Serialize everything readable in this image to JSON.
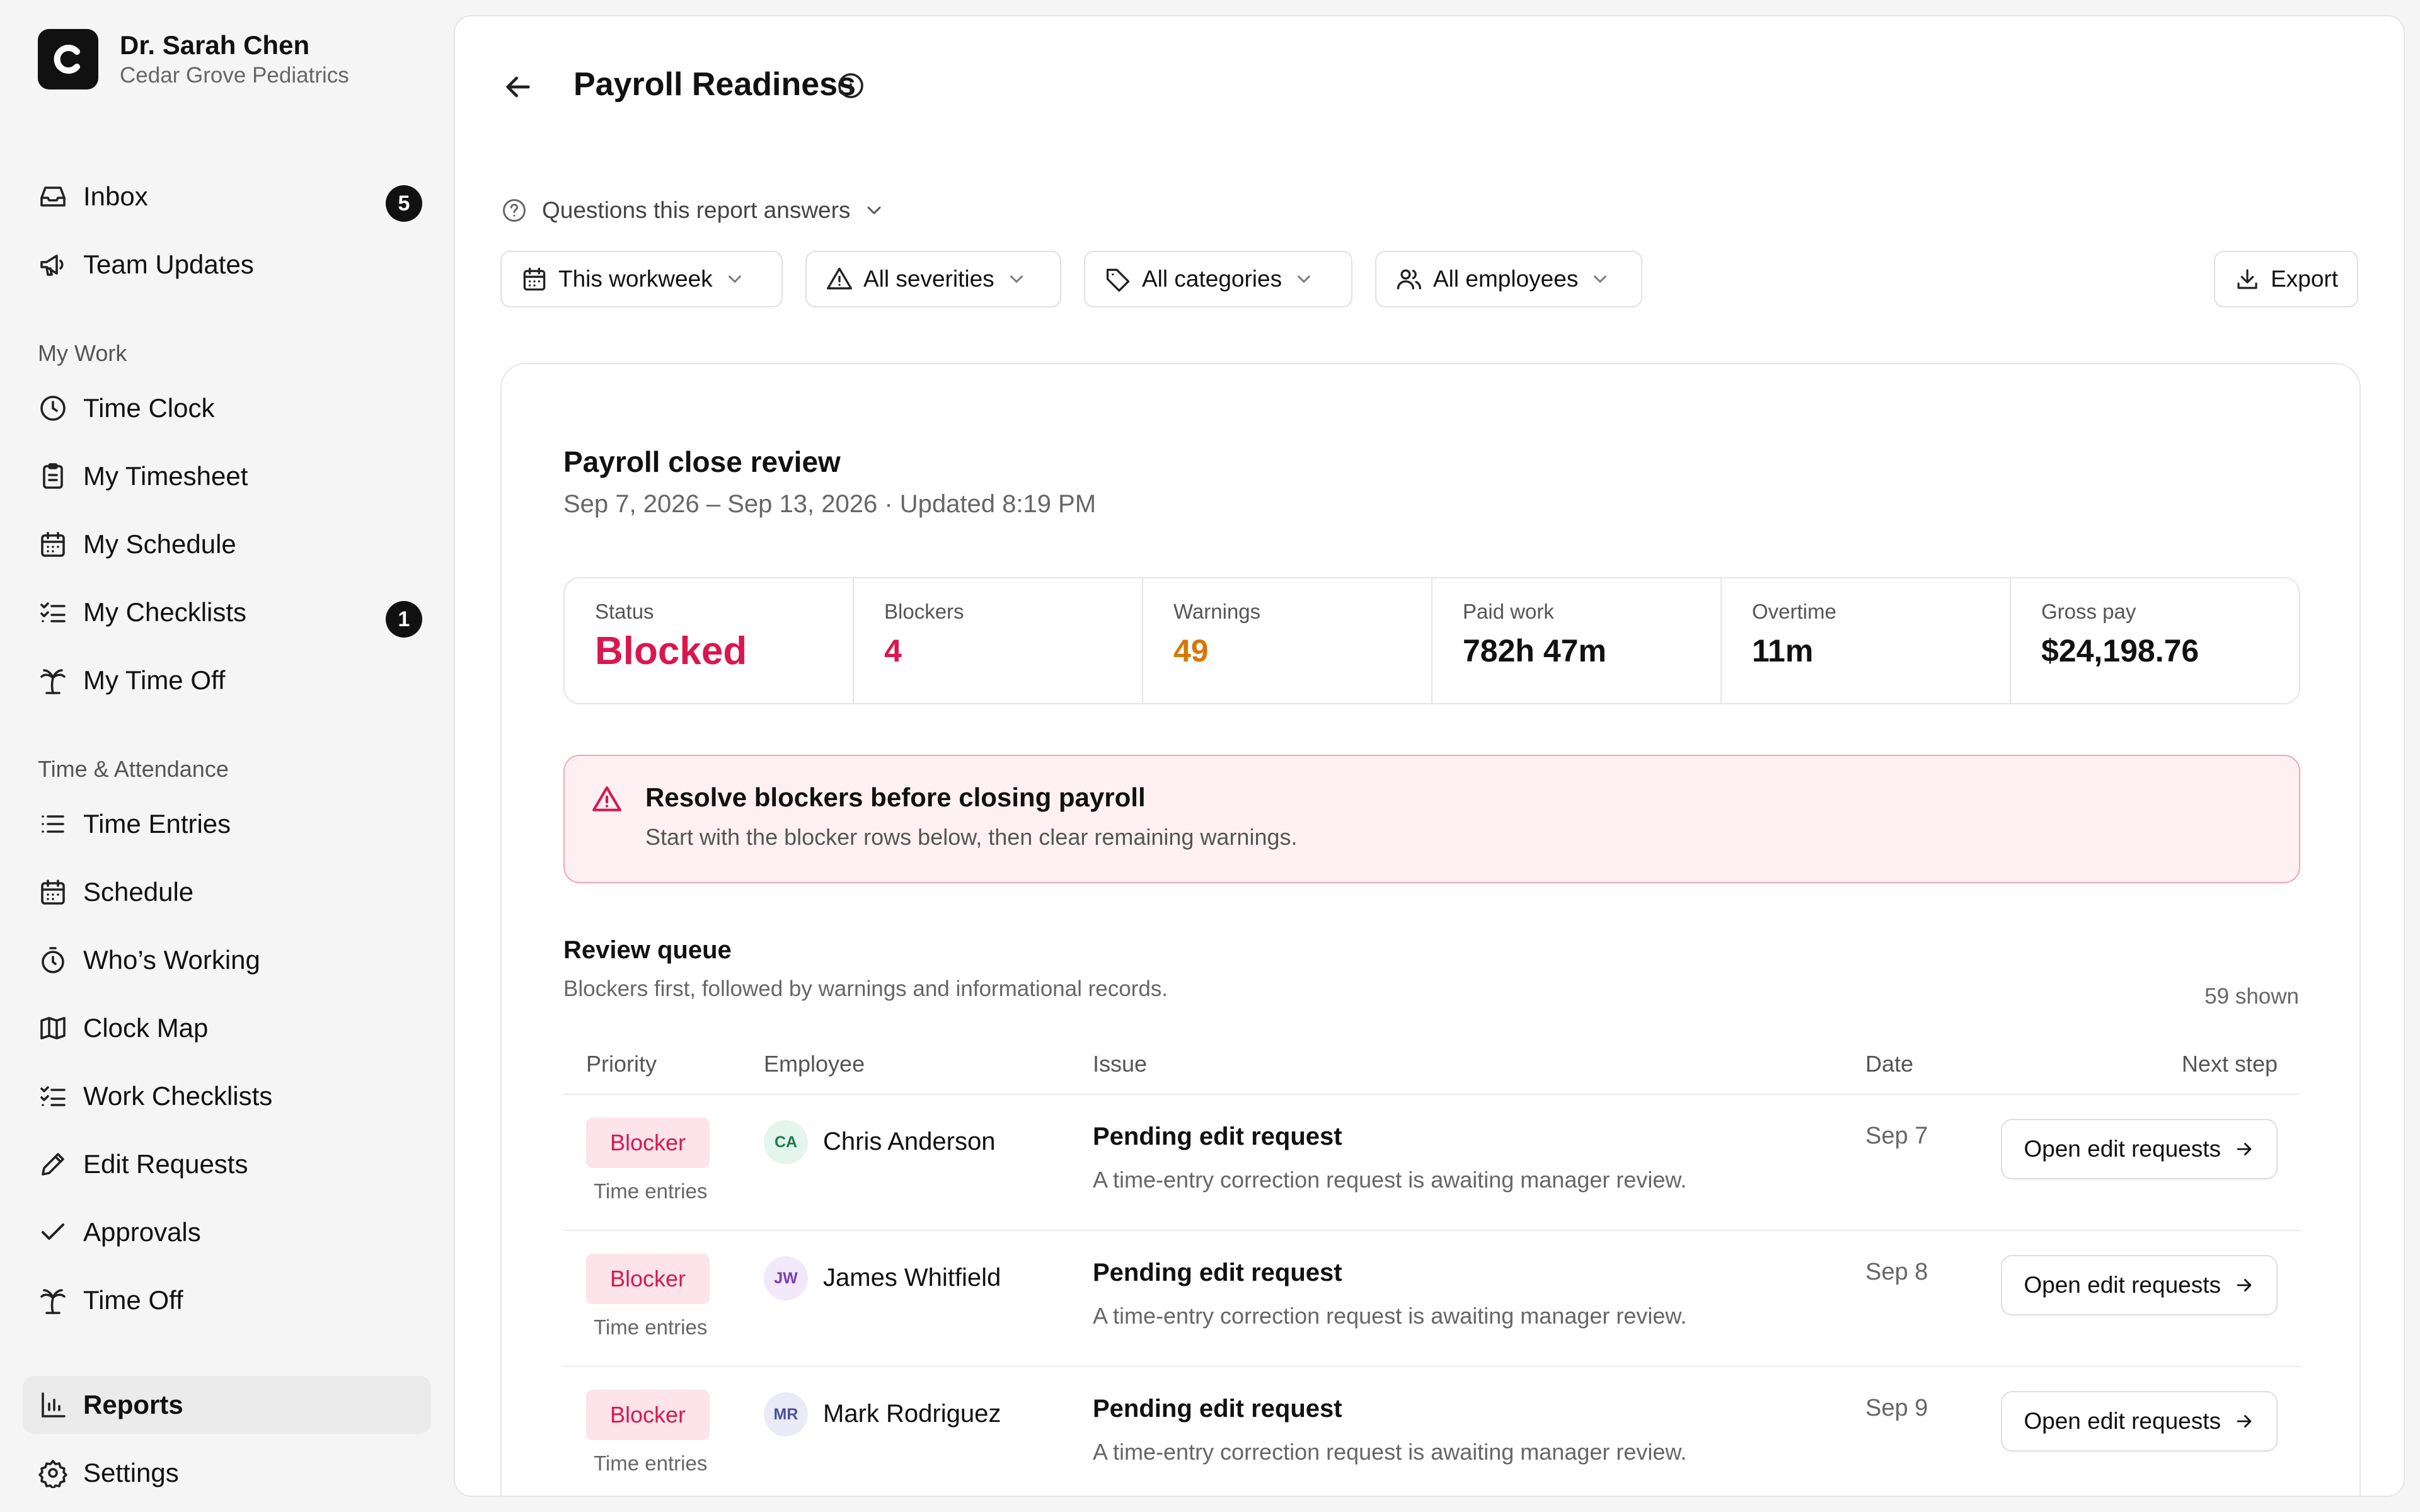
{
  "profile": {
    "name": "Dr. Sarah Chen",
    "org": "Cedar Grove Pediatrics"
  },
  "sidebar": {
    "top_items": [
      {
        "label": "Inbox",
        "badge": "5",
        "icon": "inbox-icon"
      },
      {
        "label": "Team Updates",
        "icon": "megaphone-icon"
      }
    ],
    "my_work": {
      "title": "My Work",
      "items": [
        {
          "label": "Time Clock",
          "icon": "clock-icon"
        },
        {
          "label": "My Timesheet",
          "icon": "clipboard-icon"
        },
        {
          "label": "My Schedule",
          "icon": "calendar-icon"
        },
        {
          "label": "My Checklists",
          "badge": "1",
          "icon": "checklist-icon"
        },
        {
          "label": "My Time Off",
          "icon": "palm-tree-icon"
        }
      ]
    },
    "time_attendance": {
      "title": "Time & Attendance",
      "items": [
        {
          "label": "Time Entries",
          "icon": "list-icon"
        },
        {
          "label": "Schedule",
          "icon": "calendar-icon"
        },
        {
          "label": "Who’s Working",
          "icon": "stopwatch-icon"
        },
        {
          "label": "Clock Map",
          "icon": "map-icon"
        },
        {
          "label": "Work Checklists",
          "icon": "checklist-icon"
        },
        {
          "label": "Edit Requests",
          "icon": "pencil-icon"
        },
        {
          "label": "Approvals",
          "icon": "check-icon"
        },
        {
          "label": "Time Off",
          "icon": "palm-tree-icon"
        }
      ]
    },
    "bottom_items": [
      {
        "label": "Reports",
        "icon": "bar-chart-icon",
        "active": true
      },
      {
        "label": "Settings",
        "icon": "gear-icon"
      }
    ]
  },
  "header": {
    "title": "Payroll Readiness",
    "questions_label": "Questions this report answers"
  },
  "filters": {
    "period": "This workweek",
    "severity": "All severities",
    "category": "All categories",
    "employees": "All employees",
    "export_label": "Export"
  },
  "card": {
    "title": "Payroll close review",
    "subtitle": "Sep 7, 2026 – Sep 13, 2026 · Updated 8:19 PM",
    "stats": [
      {
        "label": "Status",
        "value": "Blocked",
        "color": "#d9174f"
      },
      {
        "label": "Blockers",
        "value": "4",
        "color": "#d9174f"
      },
      {
        "label": "Warnings",
        "value": "49",
        "color": "#d97706"
      },
      {
        "label": "Paid work",
        "value": "782h 47m",
        "color": "#111111"
      },
      {
        "label": "Overtime",
        "value": "11m",
        "color": "#111111"
      },
      {
        "label": "Gross pay",
        "value": "$24,198.76",
        "color": "#111111"
      }
    ],
    "alert": {
      "title": "Resolve blockers before closing payroll",
      "body": "Start with the blocker rows below, then clear remaining warnings."
    }
  },
  "queue": {
    "title": "Review queue",
    "subtitle": "Blockers first, followed by warnings and informational records.",
    "count": "59 shown",
    "columns": {
      "priority": "Priority",
      "employee": "Employee",
      "issue": "Issue",
      "date": "Date",
      "next_step": "Next step"
    },
    "rows": [
      {
        "priority": "Blocker",
        "category": "Time entries",
        "initials": "CA",
        "employee": "Chris Anderson",
        "avatar_bg": "#e3f5ec",
        "avatar_fg": "#1e7a4f",
        "issue": "Pending edit request",
        "description": "A time-entry correction request is awaiting manager review.",
        "date": "Sep 7",
        "action": "Open edit requests"
      },
      {
        "priority": "Blocker",
        "category": "Time entries",
        "initials": "JW",
        "employee": "James Whitfield",
        "avatar_bg": "#f2e8fb",
        "avatar_fg": "#7a3fb0",
        "issue": "Pending edit request",
        "description": "A time-entry correction request is awaiting manager review.",
        "date": "Sep 8",
        "action": "Open edit requests"
      },
      {
        "priority": "Blocker",
        "category": "Time entries",
        "initials": "MR",
        "employee": "Mark Rodriguez",
        "avatar_bg": "#ebebf7",
        "avatar_fg": "#4a4f9a",
        "issue": "Pending edit request",
        "description": "A time-entry correction request is awaiting manager review.",
        "date": "Sep 9",
        "action": "Open edit requests"
      }
    ]
  }
}
